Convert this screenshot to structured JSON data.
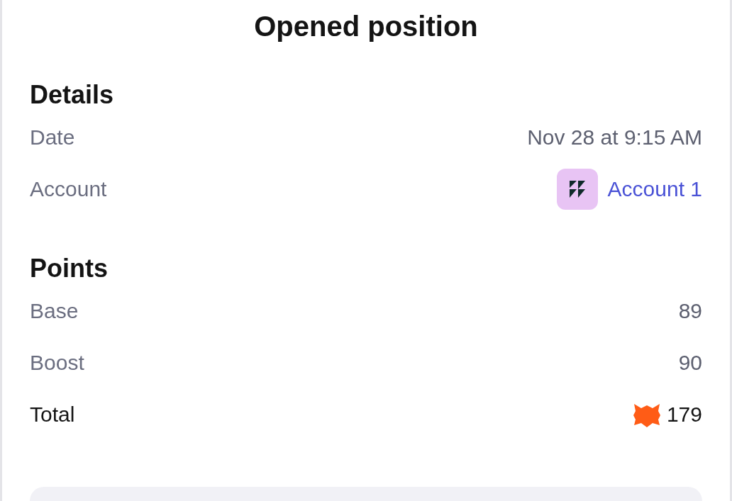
{
  "title": "Opened position",
  "sections": [
    {
      "heading": "Details",
      "rows": [
        {
          "kind": "plain",
          "label": "Date",
          "value": "Nov 28 at 9:15 AM"
        },
        {
          "kind": "account",
          "label": "Account",
          "value": "Account 1"
        }
      ]
    },
    {
      "heading": "Points",
      "rows": [
        {
          "kind": "plain",
          "label": "Base",
          "value": "89"
        },
        {
          "kind": "plain",
          "label": "Boost",
          "value": "90"
        },
        {
          "kind": "total",
          "label": "Total",
          "value": "179"
        }
      ]
    }
  ]
}
